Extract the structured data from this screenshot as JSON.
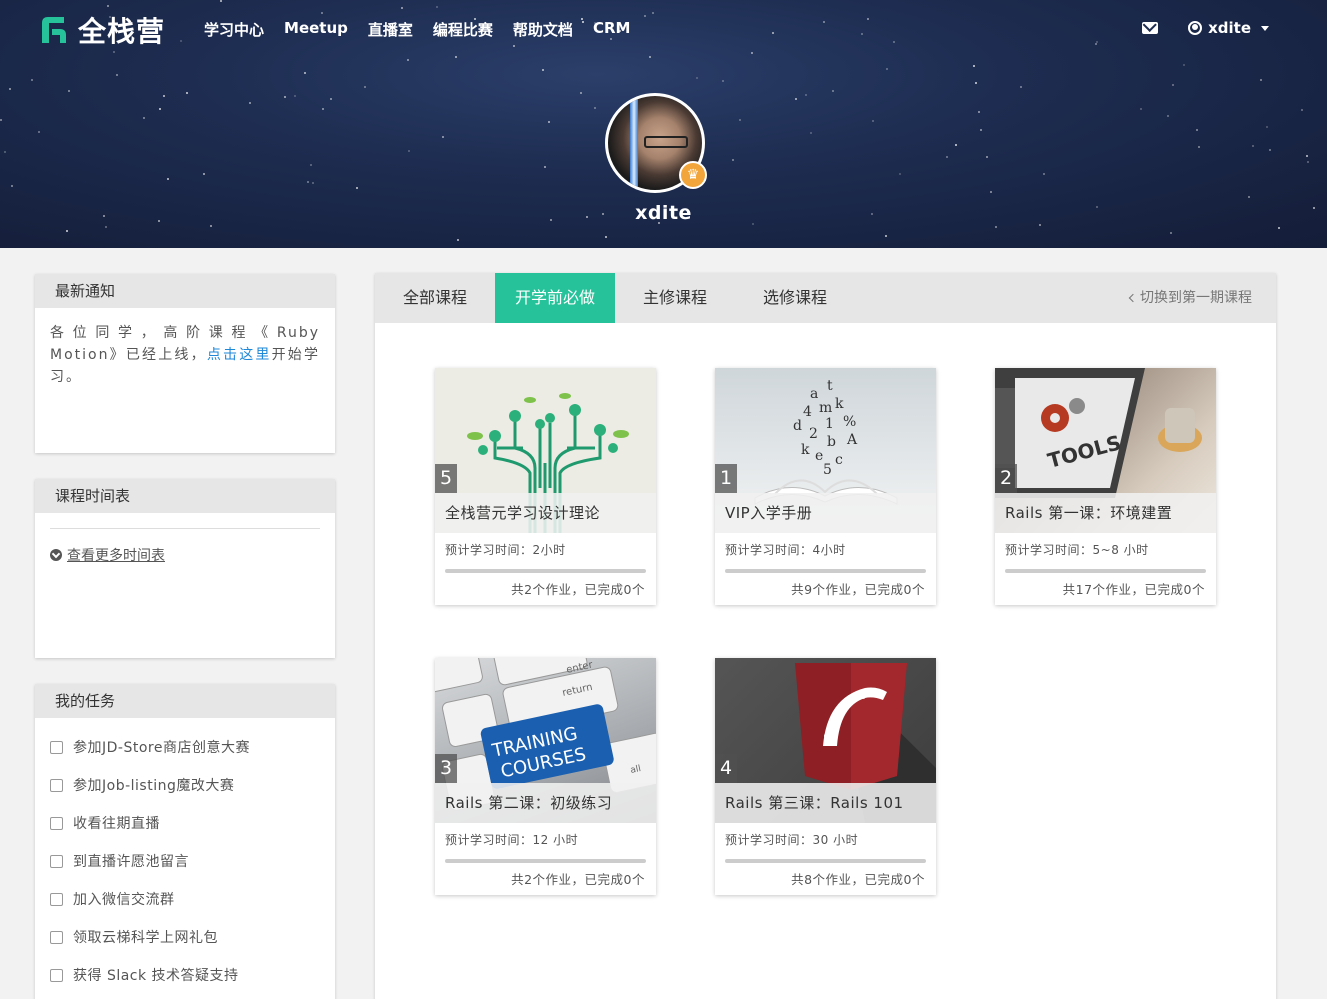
{
  "header": {
    "brand_name": "全栈营",
    "nav": [
      "学习中心",
      "Meetup",
      "直播室",
      "编程比赛",
      "帮助文档",
      "CRM"
    ],
    "mail_icon": "envelope-icon",
    "user_icon": "user-circle-icon",
    "user_name": "xdite"
  },
  "profile": {
    "username": "xdite",
    "badge_icon": "crown-icon"
  },
  "notice": {
    "title": "最新通知",
    "text_before": "各位同学，高阶课程《Ruby Motion》已经上线，",
    "link_text": "点击这里",
    "text_after": "开始学习。"
  },
  "schedule": {
    "title": "课程时间表",
    "more_label": "查看更多时间表"
  },
  "tasks": {
    "title": "我的任务",
    "items": [
      "参加JD-Store商店创意大赛",
      "参加Job-listing魔改大赛",
      "收看往期直播",
      "到直播许愿池留言",
      "加入微信交流群",
      "领取云梯科学上网礼包",
      "获得 Slack 技术答疑支持"
    ]
  },
  "main": {
    "tabs": [
      "全部课程",
      "开学前必做",
      "主修课程",
      "选修课程"
    ],
    "active_tab": "开学前必做",
    "switch_label": "切换到第一期课程",
    "accent_color": "#26c39a"
  },
  "courses": [
    {
      "num": "5",
      "title": "全栈营元学习设计理论",
      "time": "预计学习时间：2小时",
      "footer": "共2个作业，已完成0个",
      "progress": 0
    },
    {
      "num": "1",
      "title": "VIP入学手册",
      "time": "预计学习时间：4小时",
      "footer": "共9个作业，已完成0个",
      "progress": 0
    },
    {
      "num": "2",
      "title": "Rails 第一课：环境建置",
      "time": "预计学习时间：5~8 小时",
      "footer": "共17个作业，已完成0个",
      "progress": 0
    },
    {
      "num": "3",
      "title": "Rails 第二课：初级练习",
      "time": "预计学习时间：12 小时",
      "footer": "共2个作业，已完成0个",
      "progress": 0
    },
    {
      "num": "4",
      "title": "Rails 第三课：Rails 101",
      "time": "预计学习时间：30 小时",
      "footer": "共8个作业，已完成0个",
      "progress": 0
    }
  ],
  "card_images": {
    "tools_text": "TOOLS",
    "training_line1": "TRAINING",
    "training_line2": "COURSES",
    "key_enter": "enter",
    "key_return": "return",
    "key_all": "all"
  }
}
